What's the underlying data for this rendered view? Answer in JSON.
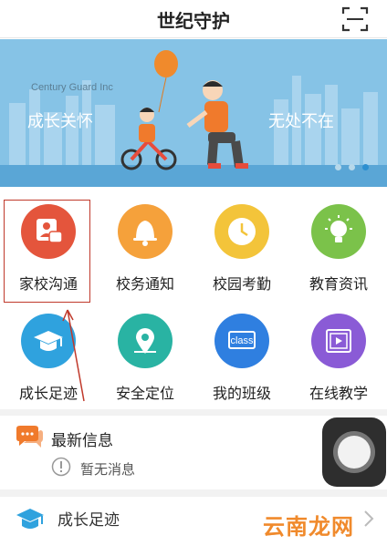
{
  "header": {
    "title": "世纪守护",
    "scan_icon": "scan-icon"
  },
  "banner": {
    "brand": "Century Guard Inc",
    "slogan_left": "成长关怀",
    "slogan_right": "无处不在",
    "dots_count": 3,
    "active_dot": 3
  },
  "grid": {
    "items": [
      {
        "label": "家校沟通",
        "icon": "chat-icon",
        "color": "#e4553c"
      },
      {
        "label": "校务通知",
        "icon": "bell-icon",
        "color": "#f5a13b"
      },
      {
        "label": "校园考勤",
        "icon": "clock-icon",
        "color": "#f3c43a"
      },
      {
        "label": "教育资讯",
        "icon": "lightbulb-icon",
        "color": "#7bc24a"
      },
      {
        "label": "成长足迹",
        "icon": "graduation-cap-icon",
        "color": "#2fa2de"
      },
      {
        "label": "安全定位",
        "icon": "map-pin-icon",
        "color": "#29b3a3"
      },
      {
        "label": "我的班级",
        "icon": "class-icon",
        "class_text": "class",
        "color": "#2f7fe0"
      },
      {
        "label": "在线教学",
        "icon": "video-play-icon",
        "color": "#8a5bd6"
      }
    ]
  },
  "news": {
    "title": "最新信息",
    "empty_text": "暂无消息",
    "icon": "chat-bubbles-icon"
  },
  "growth": {
    "title": "成长足迹",
    "icon": "graduation-cap-icon"
  },
  "watermark": {
    "text": "云南龙网"
  }
}
